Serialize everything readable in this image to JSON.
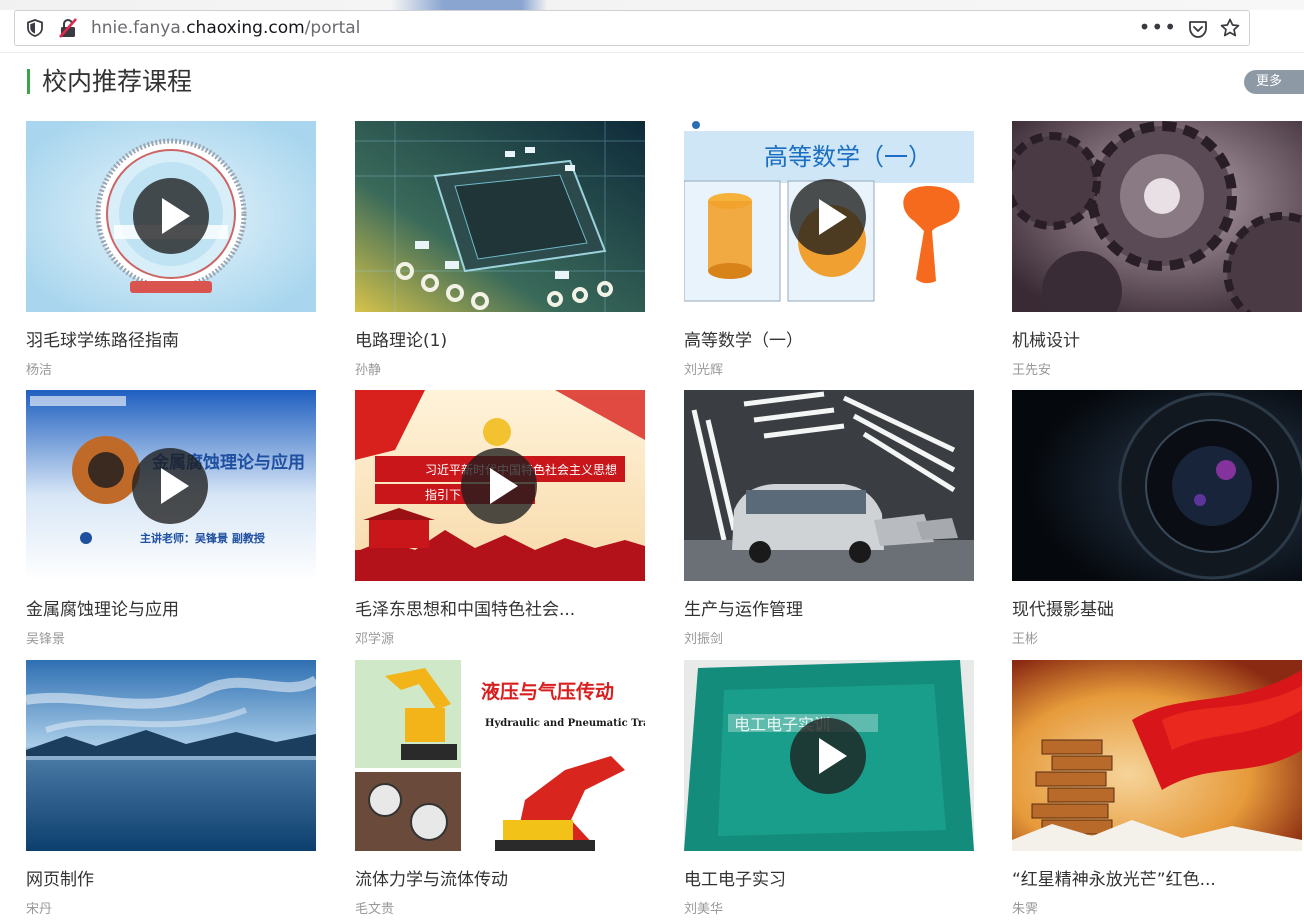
{
  "browser": {
    "url_host_prefix": "hnie.fanya.",
    "url_host": "chaoxing.com",
    "url_path": "/portal",
    "page_actions_label": "•••"
  },
  "section": {
    "title": "校内推荐课程",
    "more_label": "更多"
  },
  "courses": [
    {
      "title": "羽毛球学练路径指南",
      "teacher": "杨洁",
      "thumb": "badminton-logo",
      "has_play": true
    },
    {
      "title": "电路理论(1)",
      "teacher": "孙静",
      "thumb": "circuit-chip",
      "has_play": false
    },
    {
      "title": "高等数学（一）",
      "teacher": "刘光辉",
      "thumb": "calculus-solids",
      "has_play": true,
      "thumb_text": "高等数学（一）"
    },
    {
      "title": "机械设计",
      "teacher": "王先安",
      "thumb": "gears",
      "has_play": false
    },
    {
      "title": "金属腐蚀理论与应用",
      "teacher": "吴锋景",
      "thumb": "corroded-pipe",
      "has_play": true,
      "thumb_text": "金属腐蚀理论与应用",
      "thumb_subtext": "主讲老师：吴锋景 副教授"
    },
    {
      "title": "毛泽东思想和中国特色社会...",
      "teacher": "邓学源",
      "thumb": "party-banner",
      "has_play": true,
      "thumb_text": "习近平新时代中国特色社会主义思想",
      "thumb_subtext": "指引下"
    },
    {
      "title": "生产与运作管理",
      "teacher": "刘振剑",
      "thumb": "car-factory",
      "has_play": false
    },
    {
      "title": "现代摄影基础",
      "teacher": "王彬",
      "thumb": "camera-lens",
      "has_play": false
    },
    {
      "title": "网页制作",
      "teacher": "宋丹",
      "thumb": "lake-landscape",
      "has_play": false
    },
    {
      "title": "流体力学与流体传动",
      "teacher": "毛文贵",
      "thumb": "hydraulic-machines",
      "has_play": false,
      "thumb_text": "液压与气压传动",
      "thumb_subtext": "Hydraulic and Pneumatic Transmission"
    },
    {
      "title": "电工电子实习",
      "teacher": "刘美华",
      "thumb": "green-book",
      "has_play": true,
      "thumb_text": "电工电子实训"
    },
    {
      "title": "“红星精神永放光芒”红色...",
      "teacher": "朱霁",
      "thumb": "red-flag-blocks",
      "has_play": false
    }
  ],
  "colors": {
    "accent_bar": "#3aa44c",
    "more_button": "#8e99a6",
    "title_text": "#333333",
    "teacher_text": "#999999"
  }
}
